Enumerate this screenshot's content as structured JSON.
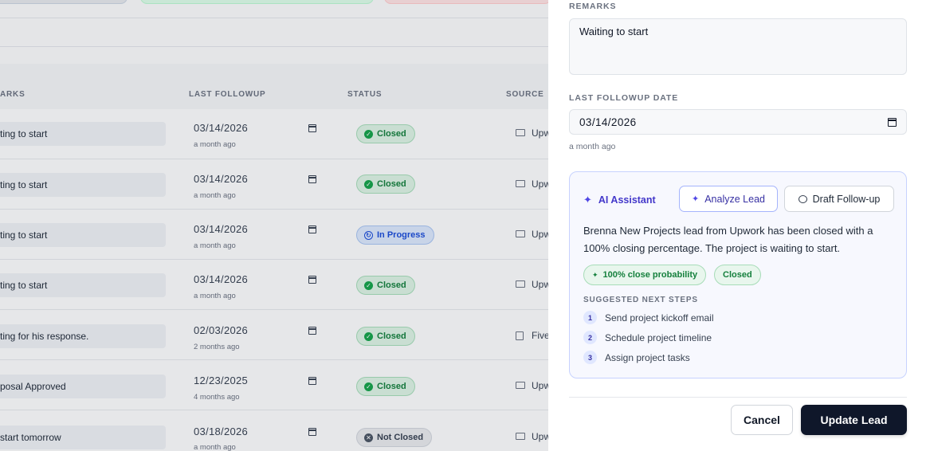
{
  "table": {
    "headers": {
      "remarks": "ARKS",
      "last_followup": "LAST FOLLOWUP",
      "status": "STATUS",
      "source": "SOURCE"
    },
    "rows": [
      {
        "remark": "ting to start",
        "date": "03/14/2026",
        "ago": "a month ago",
        "status": "Closed",
        "source": "Upw"
      },
      {
        "remark": "ting to start",
        "date": "03/14/2026",
        "ago": "a month ago",
        "status": "Closed",
        "source": "Upw"
      },
      {
        "remark": "ting to start",
        "date": "03/14/2026",
        "ago": "a month ago",
        "status": "In Progress",
        "source": "Upw"
      },
      {
        "remark": "ting to start",
        "date": "03/14/2026",
        "ago": "a month ago",
        "status": "Closed",
        "source": "Upw"
      },
      {
        "remark": "ting for his response.",
        "date": "02/03/2026",
        "ago": "2 months ago",
        "status": "Closed",
        "source": "Five"
      },
      {
        "remark": "posal Approved",
        "date": "12/23/2025",
        "ago": "4 months ago",
        "status": "Closed",
        "source": "Upw"
      },
      {
        "remark": "start tomorrow",
        "date": "03/18/2026",
        "ago": "a month ago",
        "status": "Not Closed",
        "source": "Upw"
      }
    ]
  },
  "form": {
    "remarks_label": "REMARKS",
    "remarks_value": "Waiting to start",
    "followup_label": "LAST FOLLOWUP DATE",
    "followup_value": "03/14/2026",
    "followup_hint": "a month ago"
  },
  "ai": {
    "title": "AI Assistant",
    "analyze_label": "Analyze Lead",
    "draft_label": "Draft Follow-up",
    "summary": "Brenna New Projects lead from Upwork has been closed with a 100% closing percentage. The project is waiting to start.",
    "probability_chip": "100% close probability",
    "status_chip": "Closed",
    "steps_label": "SUGGESTED NEXT STEPS",
    "steps": [
      {
        "num": "1",
        "text": "Send project kickoff email"
      },
      {
        "num": "2",
        "text": "Schedule project timeline"
      },
      {
        "num": "3",
        "text": "Assign project tasks"
      }
    ]
  },
  "footer": {
    "cancel_label": "Cancel",
    "update_label": "Update Lead"
  },
  "colors": {
    "accent": "#4338ca",
    "success": "#15803d",
    "primary_button": "#0f172a"
  }
}
